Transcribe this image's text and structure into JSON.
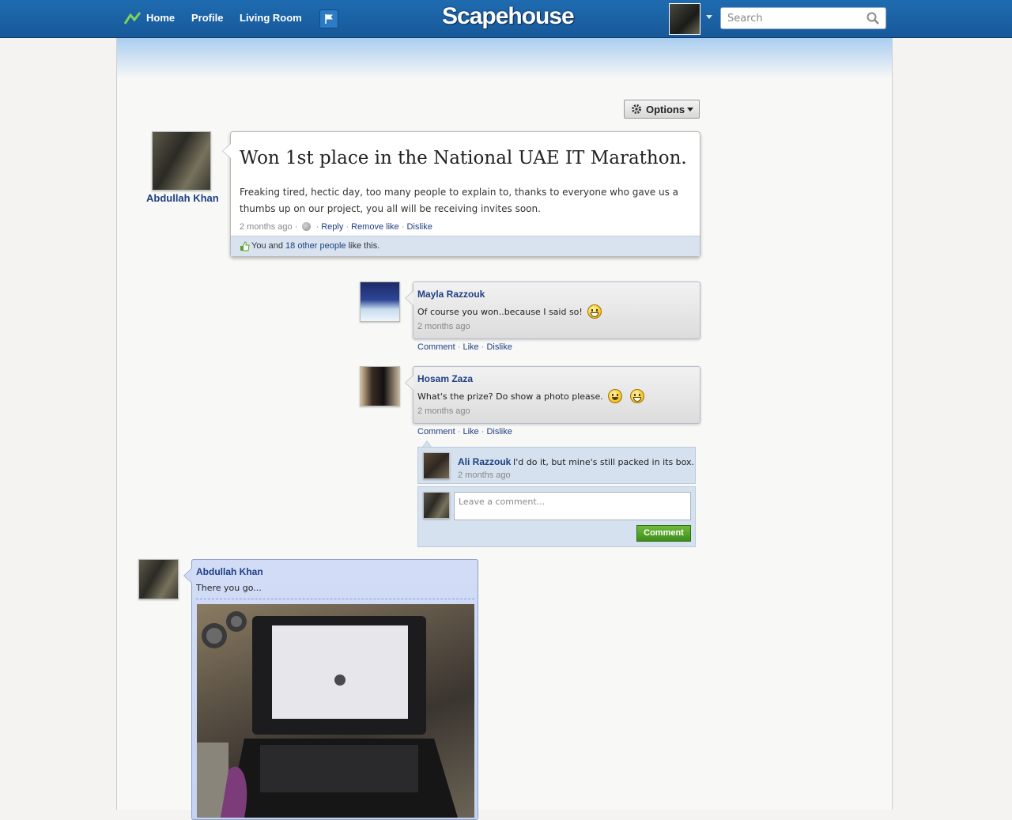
{
  "nav": {
    "links": [
      "Home",
      "Profile",
      "Living Room"
    ],
    "logo": "Scapehouse",
    "search_placeholder": "Search"
  },
  "options_label": "Options",
  "post": {
    "author": "Abdullah Khan",
    "title": "Won 1st place in the National UAE IT Marathon.",
    "body": "Freaking tired, hectic day, too many people to explain to, thanks to everyone who gave us a thumbs up on our project, you all will be receiving invites soon.",
    "time": "2 months ago",
    "actions": [
      "Reply",
      "Remove like",
      "Dislike"
    ],
    "likes": {
      "prefix": "You and",
      "link": "18 other people",
      "suffix": "like this."
    }
  },
  "comments": [
    {
      "author": "Mayla Razzouk",
      "text": "Of course you won..because I said so!",
      "time": "2 months ago",
      "actions": [
        "Comment",
        "Like",
        "Dislike"
      ]
    },
    {
      "author": "Hosam Zaza",
      "text": "What's the prize? Do show a photo please.",
      "time": "2 months ago",
      "actions": [
        "Comment",
        "Like",
        "Dislike"
      ]
    }
  ],
  "reply": {
    "author": "Ali Razzouk",
    "text": "I'd do it, but mine's still packed in its box.",
    "time": "2 months ago"
  },
  "composer": {
    "placeholder": "Leave a comment...",
    "button": "Comment"
  },
  "photo_post": {
    "author": "Abdullah Khan",
    "text": "There you go..."
  },
  "colors": {
    "topbar": "#17599a",
    "link": "#1f3f84",
    "comment_button": "#4f9f28",
    "like_bar": "#d8e3ef"
  }
}
